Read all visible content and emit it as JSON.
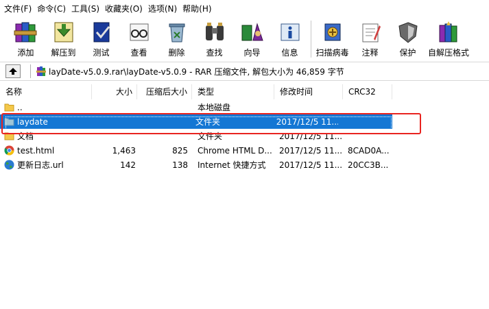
{
  "menu": {
    "items": [
      "文件(F)",
      "命令(C)",
      "工具(S)",
      "收藏夹(O)",
      "选项(N)",
      "帮助(H)"
    ]
  },
  "toolbar": {
    "buttons": [
      {
        "label": "添加",
        "icon": "rar-books-add-icon"
      },
      {
        "label": "解压到",
        "icon": "extract-folder-icon"
      },
      {
        "label": "测试",
        "icon": "test-book-check-icon"
      },
      {
        "label": "查看",
        "icon": "view-glasses-icon"
      },
      {
        "label": "删除",
        "icon": "delete-recycle-icon"
      },
      {
        "label": "查找",
        "icon": "find-binoculars-icon"
      },
      {
        "label": "向导",
        "icon": "wizard-icon"
      },
      {
        "label": "信息",
        "icon": "info-icon"
      },
      {
        "label": "扫描病毒",
        "icon": "virus-scan-icon"
      },
      {
        "label": "注释",
        "icon": "comment-icon"
      },
      {
        "label": "保护",
        "icon": "protect-shield-icon"
      },
      {
        "label": "自解压格式",
        "icon": "sfx-books-icon"
      }
    ]
  },
  "address": {
    "path": "layDate-v5.0.9.rar\\layDate-v5.0.9 - RAR 压缩文件, 解包大小为 46,859 字节"
  },
  "columns": {
    "name": "名称",
    "size": "大小",
    "packed": "压缩后大小",
    "type": "类型",
    "modified": "修改时间",
    "crc": "CRC32"
  },
  "files": [
    {
      "name": "..",
      "size": "",
      "packed": "",
      "type": "本地磁盘",
      "modified": "",
      "crc": "",
      "icon": "folder-icon"
    },
    {
      "name": "laydate",
      "size": "",
      "packed": "",
      "type": "文件夹",
      "modified": "2017/12/5 11...",
      "crc": "",
      "icon": "folder-icon"
    },
    {
      "name": "文档",
      "size": "",
      "packed": "",
      "type": "文件夹",
      "modified": "2017/12/5 11...",
      "crc": "",
      "icon": "folder-icon"
    },
    {
      "name": "test.html",
      "size": "1,463",
      "packed": "825",
      "type": "Chrome HTML D...",
      "modified": "2017/12/5 11...",
      "crc": "8CAD0A...",
      "icon": "chrome-icon"
    },
    {
      "name": "更新日志.url",
      "size": "142",
      "packed": "138",
      "type": "Internet 快捷方式",
      "modified": "2017/12/5 11...",
      "crc": "20CC3B...",
      "icon": "globe-icon"
    }
  ],
  "colors": {
    "selection": "#1477d4",
    "highlight_box": "#e8231f",
    "folder": "#f4c84a"
  }
}
